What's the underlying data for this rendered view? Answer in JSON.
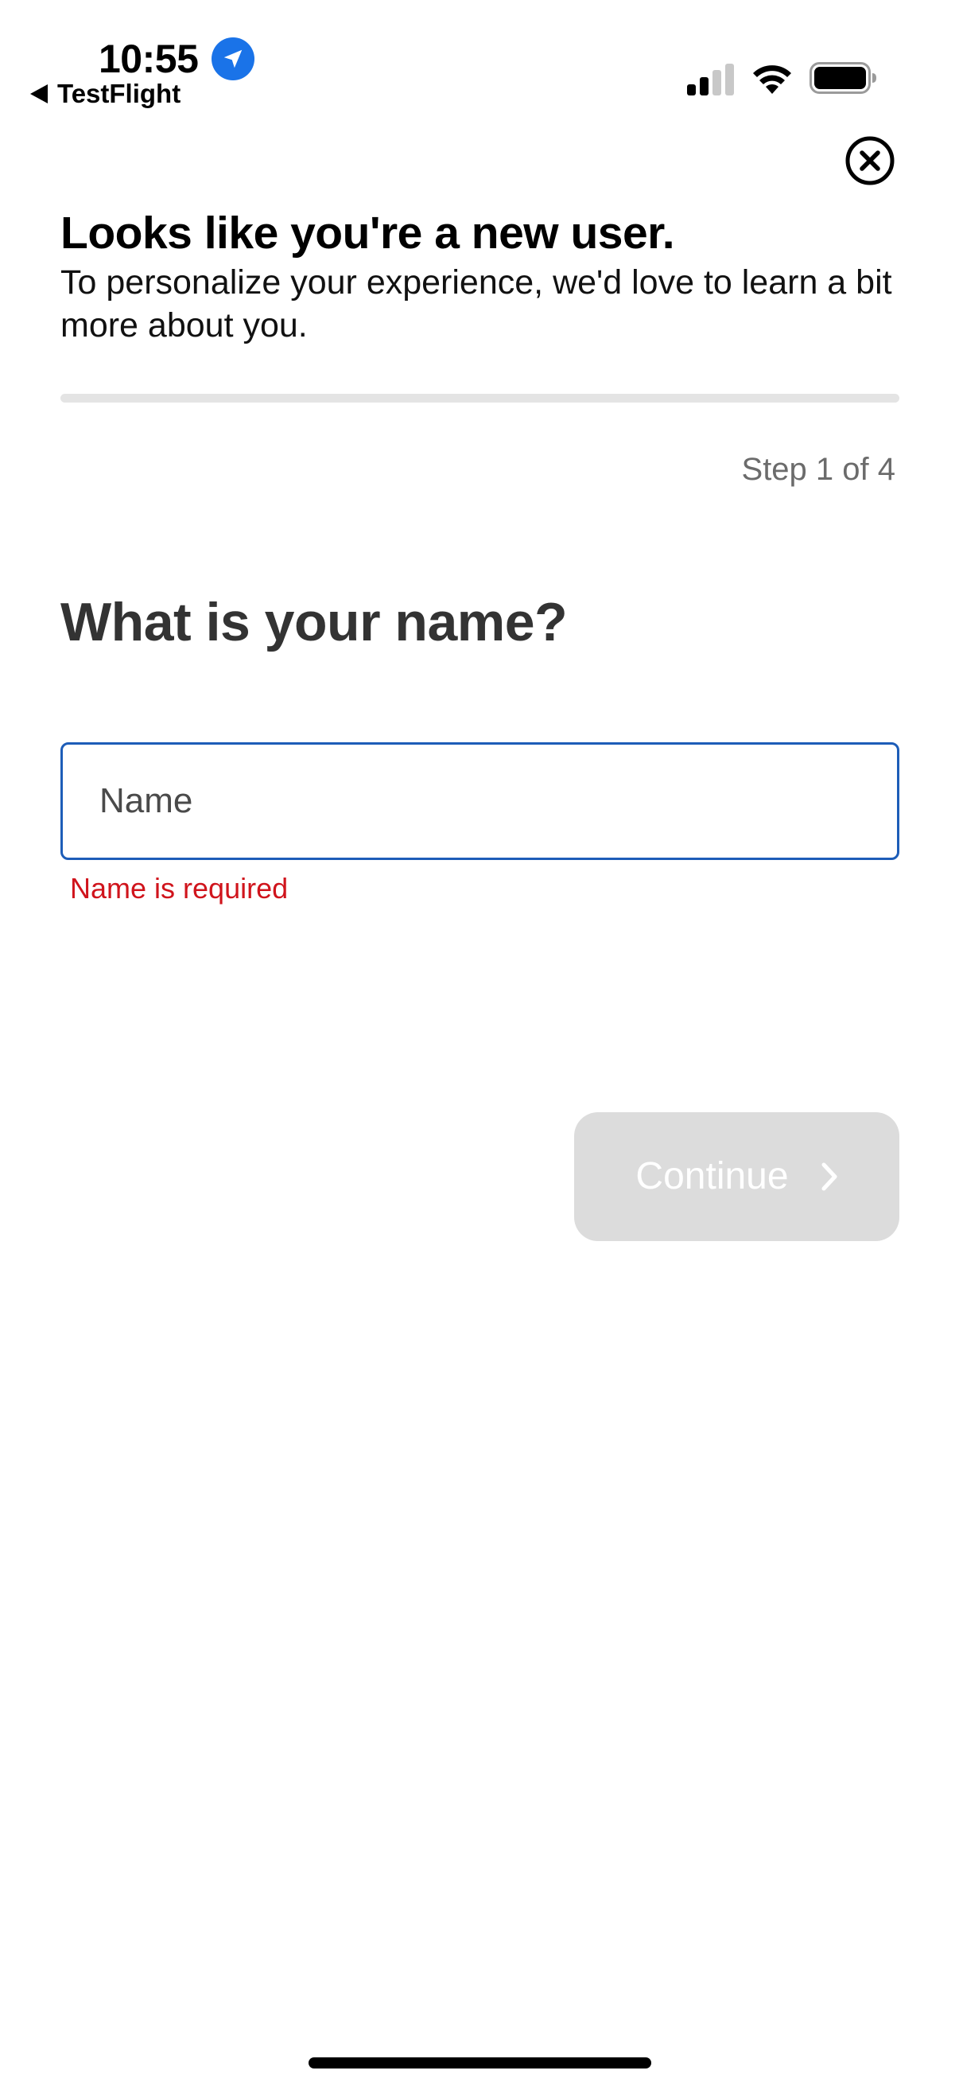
{
  "status_bar": {
    "time": "10:55",
    "back_app_label": "TestFlight",
    "icons": [
      "location-arrow-icon",
      "cellular-signal-icon",
      "wifi-icon",
      "battery-icon"
    ]
  },
  "header": {
    "close_icon": "close-circle-icon",
    "title": "Looks like you're a new user.",
    "subtitle": "To personalize your experience, we'd love to learn a bit more about you."
  },
  "progress": {
    "step_text": "Step 1 of 4",
    "fill_fraction": 0
  },
  "question": {
    "text": "What is your name?"
  },
  "name_field": {
    "placeholder": "Name",
    "value": "",
    "error": "Name is required"
  },
  "continue_button": {
    "label": "Continue",
    "icon": "chevron-right-icon",
    "enabled": false
  },
  "colors": {
    "accent_blue": "#1d5db8",
    "location_blue": "#1a73e8",
    "error_red": "#d0141c",
    "disabled_button": "#dcdcdc",
    "progress_track": "#e4e4e4"
  }
}
